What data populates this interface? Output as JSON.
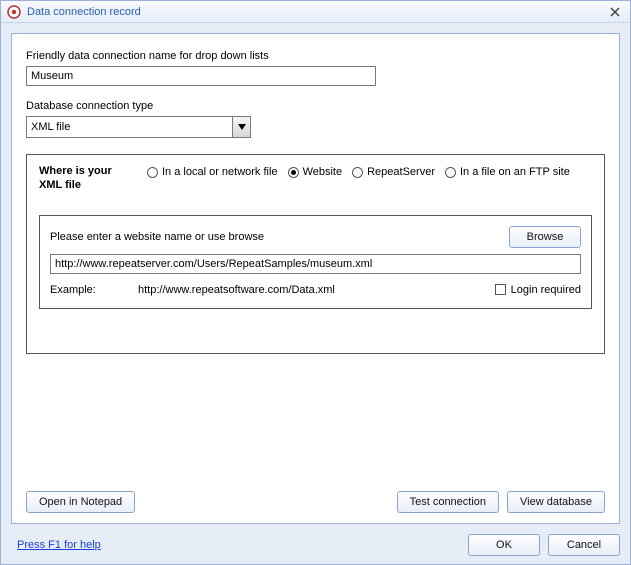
{
  "window": {
    "title": "Data connection record"
  },
  "friendly": {
    "label": "Friendly data connection name for drop down lists",
    "value": "Museum"
  },
  "dbtype": {
    "label": "Database connection type",
    "selected": "XML file"
  },
  "location": {
    "prompt": "Where is your XML file",
    "options": {
      "local": "In a local or network file",
      "website": "Website",
      "repeatserver": "RepeatServer",
      "ftp": "In a file on an FTP site"
    },
    "selected": "website"
  },
  "website": {
    "prompt": "Please enter a website name or use browse",
    "browse": "Browse",
    "value": "http://www.repeatserver.com/Users/RepeatSamples/museum.xml",
    "example_label": "Example:",
    "example_value": "http://www.repeatsoftware.com/Data.xml",
    "login_required_label": "Login required",
    "login_required": false
  },
  "buttons": {
    "open_notepad": "Open in Notepad",
    "test_connection": "Test connection",
    "view_database": "View database",
    "ok": "OK",
    "cancel": "Cancel"
  },
  "help": {
    "text": "Press F1 for help"
  }
}
